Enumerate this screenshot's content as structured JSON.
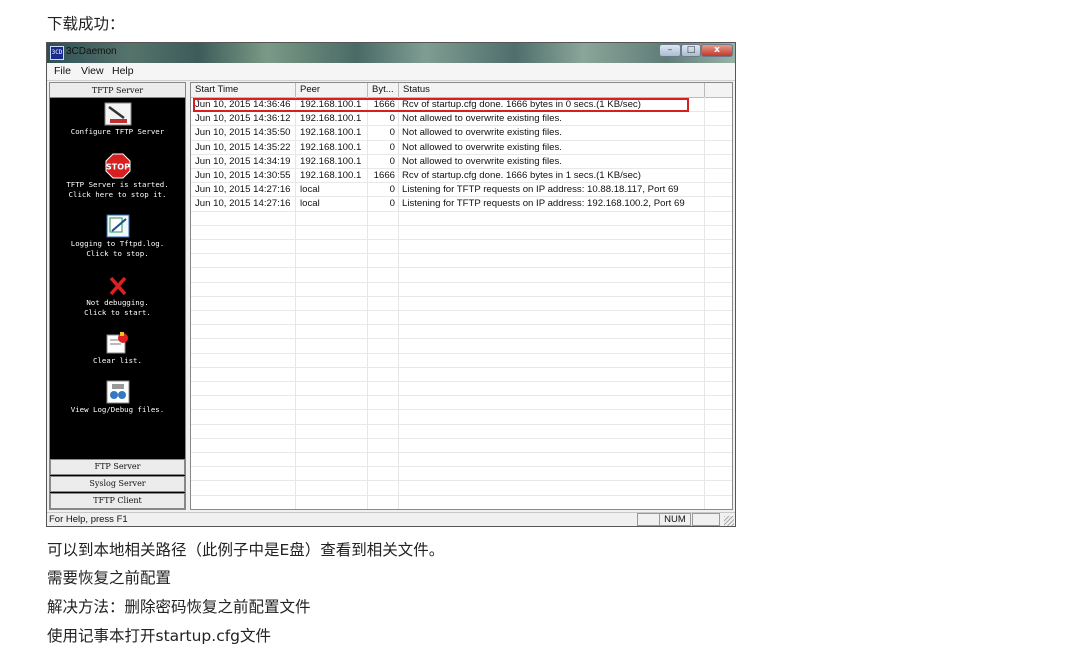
{
  "doc": {
    "caption_top": "下载成功：",
    "line1": "可以到本地相关路径（此例子中是E盘）查看到相关文件。",
    "line2": "需要恢复之前配置",
    "line3": "解决方法：删除密码恢复之前配置文件",
    "line4": "使用记事本打开startup.cfg文件"
  },
  "window": {
    "title": "3CDaemon",
    "icon_text": "3CD",
    "buttons": {
      "minimize": "–",
      "maximize": "□",
      "close": "x"
    }
  },
  "menu": [
    "File",
    "View",
    "Help"
  ],
  "sidebar": {
    "header": "TFTP Server",
    "tools": [
      {
        "label": "Configure TFTP Server",
        "icon": "configure-icon"
      },
      {
        "label": "TFTP Server is started.\nClick here to stop it.",
        "icon": "stop-icon",
        "icon_text": "STOP"
      },
      {
        "label": "Logging to Tftpd.log.\nClick to stop.",
        "icon": "logging-icon"
      },
      {
        "label": "Not debugging.\nClick to start.",
        "icon": "debug-icon"
      },
      {
        "label": "Clear list.",
        "icon": "clear-list-icon"
      },
      {
        "label": "View Log/Debug files.",
        "icon": "view-log-icon"
      }
    ],
    "bottom_tabs": [
      "FTP Server",
      "Syslog Server",
      "TFTP Client"
    ]
  },
  "table": {
    "columns": [
      "Start Time",
      "Peer",
      "Byt...",
      "Status"
    ],
    "rows": [
      {
        "time": "Jun 10, 2015 14:36:46",
        "peer": "192.168.100.1",
        "bytes": "1666",
        "status": "Rcv of startup.cfg done. 1666 bytes in 0 secs.(1 KB/sec)"
      },
      {
        "time": "Jun 10, 2015 14:36:12",
        "peer": "192.168.100.1",
        "bytes": "0",
        "status": "Not allowed to overwrite existing files."
      },
      {
        "time": "Jun 10, 2015 14:35:50",
        "peer": "192.168.100.1",
        "bytes": "0",
        "status": "Not allowed to overwrite existing files."
      },
      {
        "time": "Jun 10, 2015 14:35:22",
        "peer": "192.168.100.1",
        "bytes": "0",
        "status": "Not allowed to overwrite existing files."
      },
      {
        "time": "Jun 10, 2015 14:34:19",
        "peer": "192.168.100.1",
        "bytes": "0",
        "status": "Not allowed to overwrite existing files."
      },
      {
        "time": "Jun 10, 2015 14:30:55",
        "peer": "192.168.100.1",
        "bytes": "1666",
        "status": "Rcv of startup.cfg done. 1666 bytes in 1 secs.(1 KB/sec)"
      },
      {
        "time": "Jun 10, 2015 14:27:16",
        "peer": "local",
        "bytes": "0",
        "status": "Listening for TFTP requests on IP address: 10.88.18.117, Port 69"
      },
      {
        "time": "Jun 10, 2015 14:27:16",
        "peer": "local",
        "bytes": "0",
        "status": "Listening for TFTP requests on IP address: 192.168.100.2, Port 69"
      }
    ]
  },
  "statusbar": {
    "help": "For Help, press F1",
    "num": "NUM"
  },
  "colors": {
    "highlight": "#d42020",
    "sidebar_bg": "#000000",
    "stop_red": "#d61f1f"
  }
}
